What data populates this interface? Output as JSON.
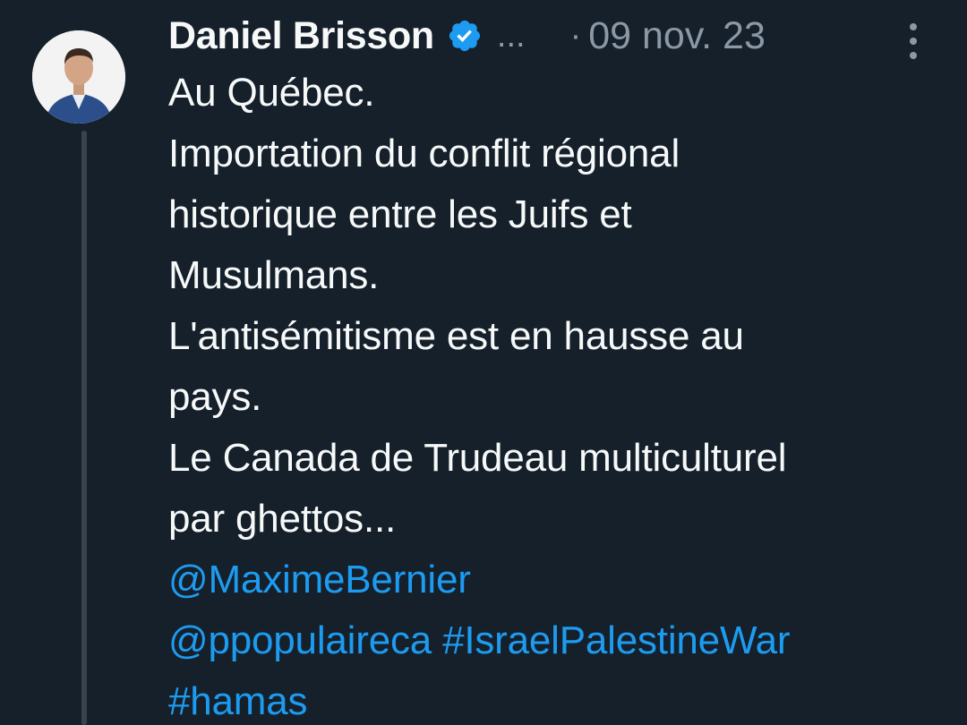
{
  "tweet": {
    "author": {
      "display_name": "Daniel Brisson",
      "handle_truncated": "...",
      "verified": true,
      "avatar_icon": "profile-photo"
    },
    "separator": "·",
    "date": "09 nov. 23",
    "more_icon": "more-vertical-icon",
    "lines": [
      "Au Québec.",
      "Importation du conflit régional",
      "historique entre les Juifs et",
      "Musulmans.",
      "L'antisémitisme est en hausse au",
      "pays.",
      "Le Canada de Trudeau multiculturel",
      "par ghettos..."
    ],
    "mention_1": "@MaximeBernier",
    "mention_2": "@ppopulaireca",
    "hashtag_1": "#IsraelPalestineWar",
    "hashtag_2": "#hamas"
  },
  "colors": {
    "background": "#15202b",
    "text": "#f7f9f9",
    "secondary": "#8b98a5",
    "link": "#1d9bf0",
    "verified_badge": "#1d9bf0",
    "thread_line": "#38444d"
  }
}
